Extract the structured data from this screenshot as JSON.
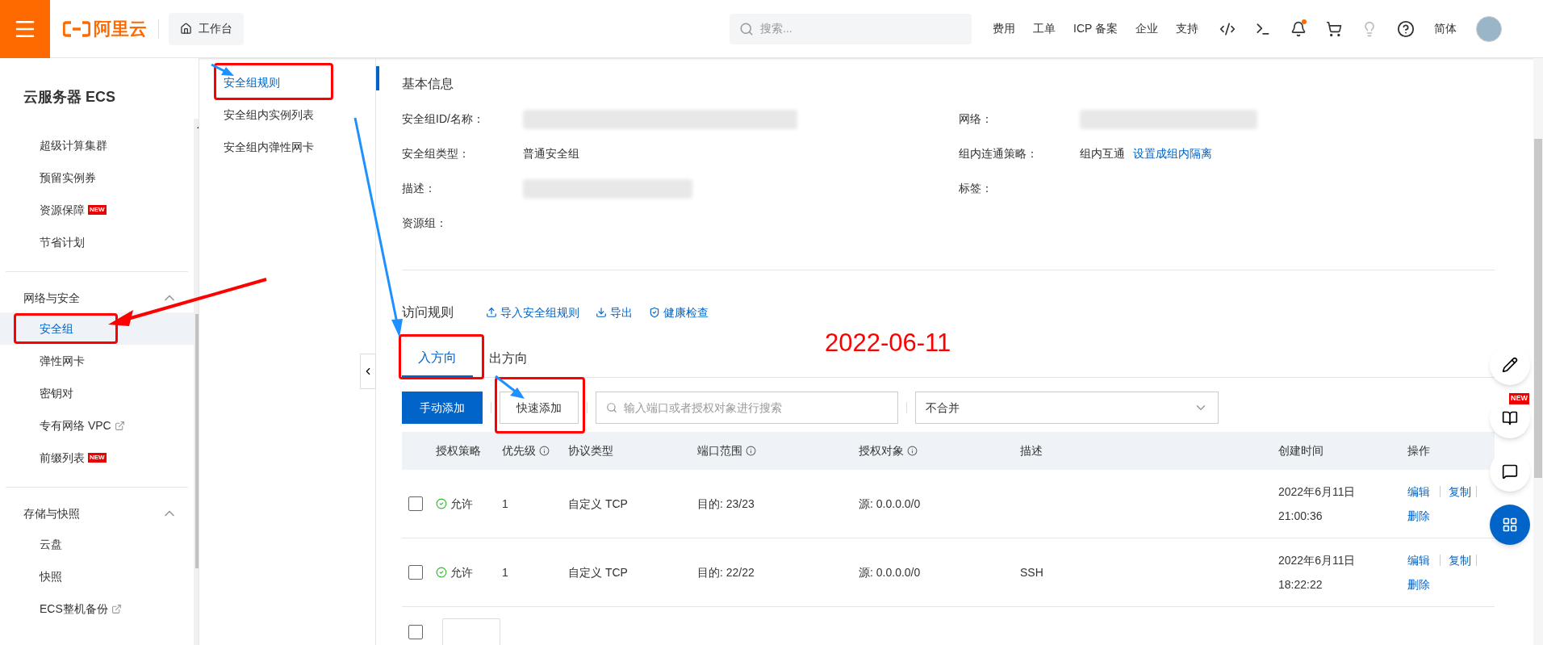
{
  "topbar": {
    "brand": "阿里云",
    "workbench": "工作台",
    "search": {
      "placeholder": "搜索..."
    },
    "links": [
      "费用",
      "工单",
      "ICP 备案",
      "企业",
      "支持"
    ],
    "notification_dot": true,
    "language": "简体"
  },
  "sidebar": {
    "title": "云服务器 ECS",
    "items": [
      {
        "label": "超级计算集群",
        "selected": false
      },
      {
        "label": "预留实例券",
        "selected": false
      },
      {
        "label": "资源保障",
        "badge": "NEW",
        "selected": false
      },
      {
        "label": "节省计划",
        "selected": false
      }
    ],
    "groups": [
      {
        "label": "网络与安全",
        "expanded": true,
        "items": [
          {
            "label": "安全组",
            "selected": true
          },
          {
            "label": "弹性网卡",
            "selected": false
          },
          {
            "label": "密钥对",
            "selected": false
          },
          {
            "label": "专有网络 VPC",
            "external": true,
            "selected": false
          },
          {
            "label": "前缀列表",
            "badge": "NEW",
            "selected": false
          }
        ]
      },
      {
        "label": "存储与快照",
        "expanded": true,
        "items": [
          {
            "label": "云盘",
            "selected": false
          },
          {
            "label": "快照",
            "selected": false
          },
          {
            "label": "ECS整机备份",
            "external": true,
            "selected": false
          }
        ]
      }
    ]
  },
  "subnav": [
    {
      "label": "安全组规则",
      "selected": true
    },
    {
      "label": "安全组内实例列表",
      "selected": false
    },
    {
      "label": "安全组内弹性网卡",
      "selected": false
    }
  ],
  "basic_info": {
    "title": "基本信息",
    "fields": [
      {
        "label": "安全组ID/名称：",
        "redacted": true
      },
      {
        "label": "网络：",
        "redacted": true
      },
      {
        "label": "安全组类型：",
        "value": "普通安全组"
      },
      {
        "label": "组内连通策略：",
        "value": "组内互通",
        "link": "设置成组内隔离"
      },
      {
        "label": "描述：",
        "redacted": true
      },
      {
        "label": "标签："
      },
      {
        "label": "资源组："
      }
    ]
  },
  "annotation": {
    "text": "2022-06-11"
  },
  "rules": {
    "title": "访问规则",
    "actions": [
      {
        "label": "导入安全组规则",
        "kind": "upload"
      },
      {
        "label": "导出",
        "kind": "download"
      },
      {
        "label": "健康检查",
        "kind": "shield"
      }
    ],
    "tabs": [
      {
        "label": "入方向",
        "selected": true
      },
      {
        "label": "出方向",
        "selected": false
      }
    ],
    "toolbar": {
      "primary": "手动添加",
      "secondary": "快速添加",
      "search_placeholder": "输入端口或者授权对象进行搜索",
      "merge": "不合并"
    },
    "columns": [
      {
        "label": "授权策略"
      },
      {
        "label": "优先级",
        "info": true
      },
      {
        "label": "协议类型"
      },
      {
        "label": "端口范围",
        "info": true
      },
      {
        "label": "授权对象",
        "info": true
      },
      {
        "label": "描述"
      },
      {
        "label": "创建时间"
      },
      {
        "label": "操作"
      }
    ],
    "rows": [
      {
        "checked": false,
        "policy": "允许",
        "priority": "1",
        "protocol": "自定义 TCP",
        "port": "目的: 23/23",
        "source": "源: 0.0.0.0/0",
        "date": "2022年6月11日",
        "time": "21:00:36",
        "actions": [
          "编辑",
          "复制",
          "删除"
        ]
      },
      {
        "checked": false,
        "policy": "允许",
        "priority": "1",
        "protocol": "自定义 TCP",
        "port": "目的: 22/22",
        "source": "源: 0.0.0.0/0",
        "description": "SSH",
        "date": "2022年6月11日",
        "time": "18:22:22",
        "actions": [
          "编辑",
          "复制",
          "删除"
        ]
      }
    ],
    "select_all": {
      "checked": false
    }
  },
  "floating": {
    "new_badge": "NEW"
  }
}
